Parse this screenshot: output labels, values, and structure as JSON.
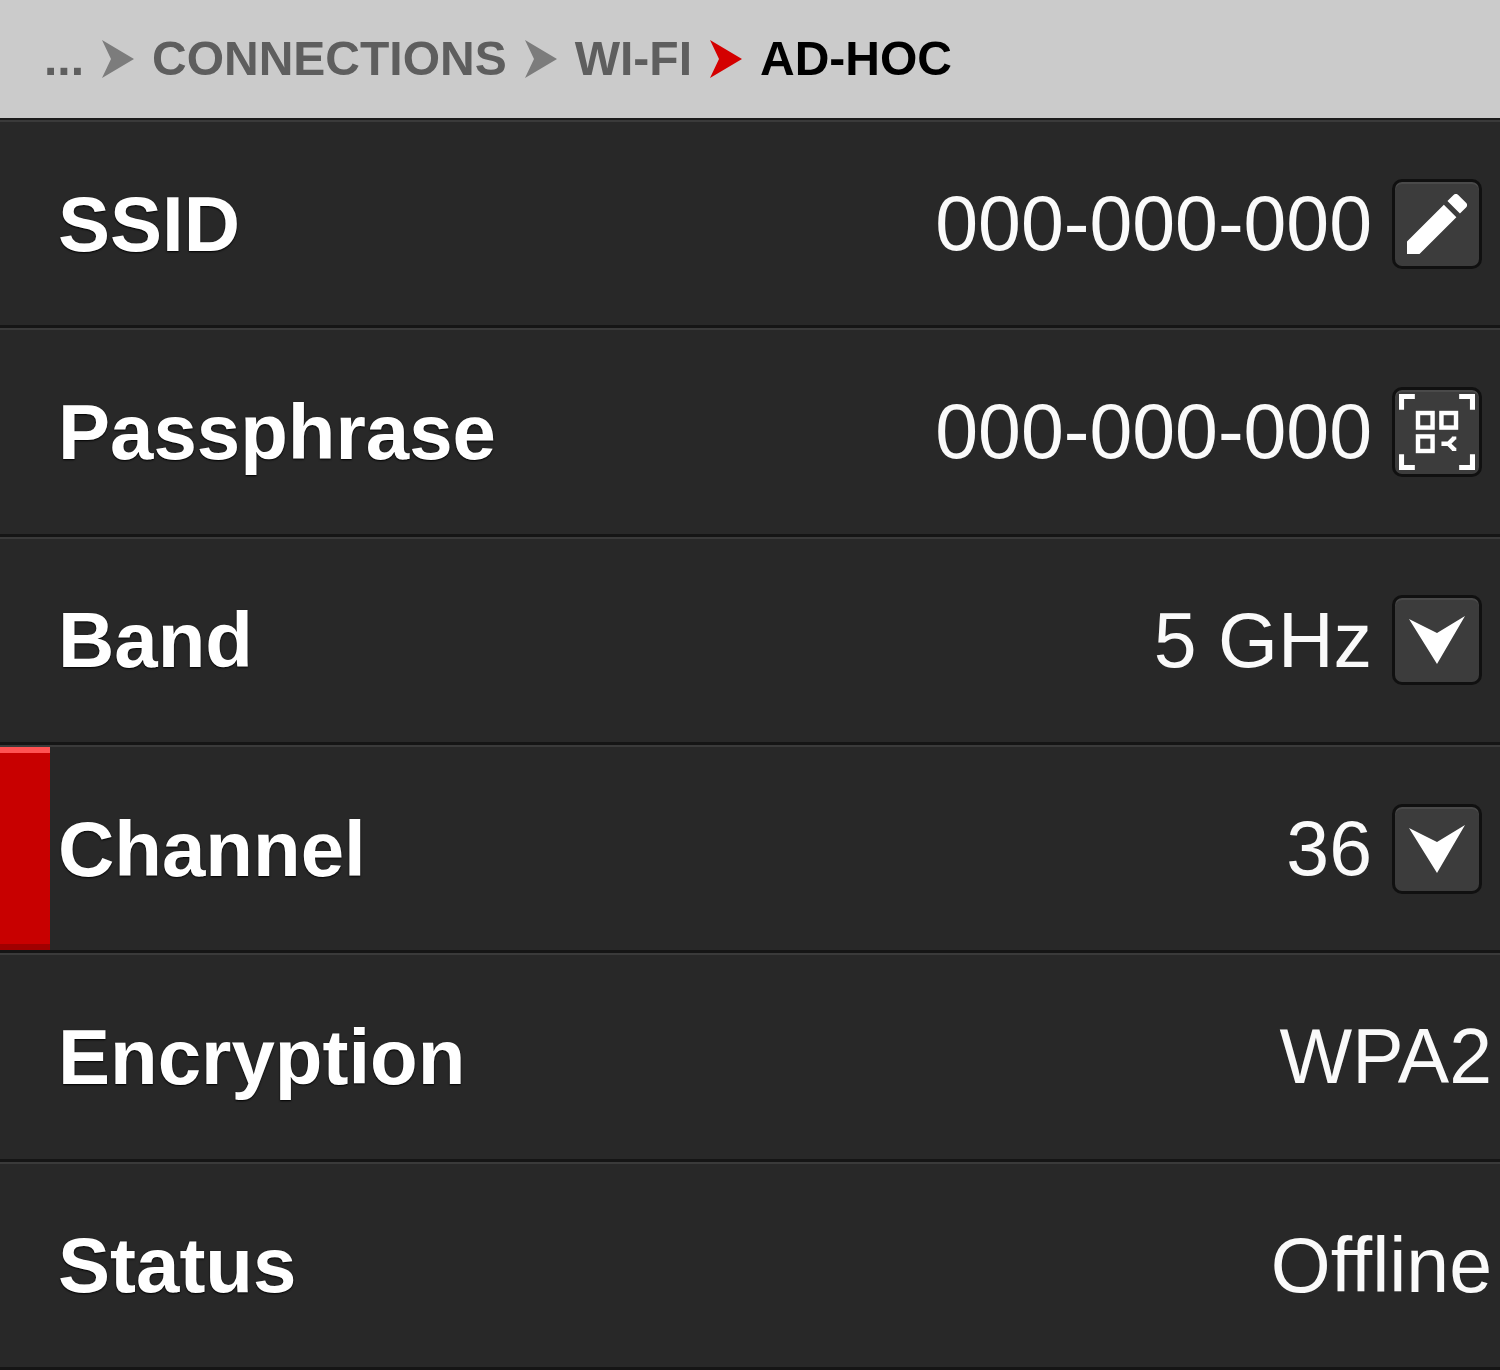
{
  "breadcrumb": {
    "items": [
      {
        "label": "...",
        "current": false
      },
      {
        "label": "CONNECTIONS",
        "current": false
      },
      {
        "label": "WI-FI",
        "current": false
      },
      {
        "label": "AD-HOC",
        "current": true
      }
    ]
  },
  "rows": [
    {
      "label": "SSID",
      "value": "000-000-000",
      "kind": "edit",
      "selected": false
    },
    {
      "label": "Passphrase",
      "value": "000-000-000",
      "kind": "scan",
      "selected": false
    },
    {
      "label": "Band",
      "value": "5 GHz",
      "kind": "dropdown",
      "selected": false
    },
    {
      "label": "Channel",
      "value": "36",
      "kind": "dropdown",
      "selected": true
    },
    {
      "label": "Encryption",
      "value": "WPA2",
      "kind": "text",
      "selected": false
    },
    {
      "label": "Status",
      "value": "Offline",
      "kind": "text",
      "selected": false
    }
  ]
}
